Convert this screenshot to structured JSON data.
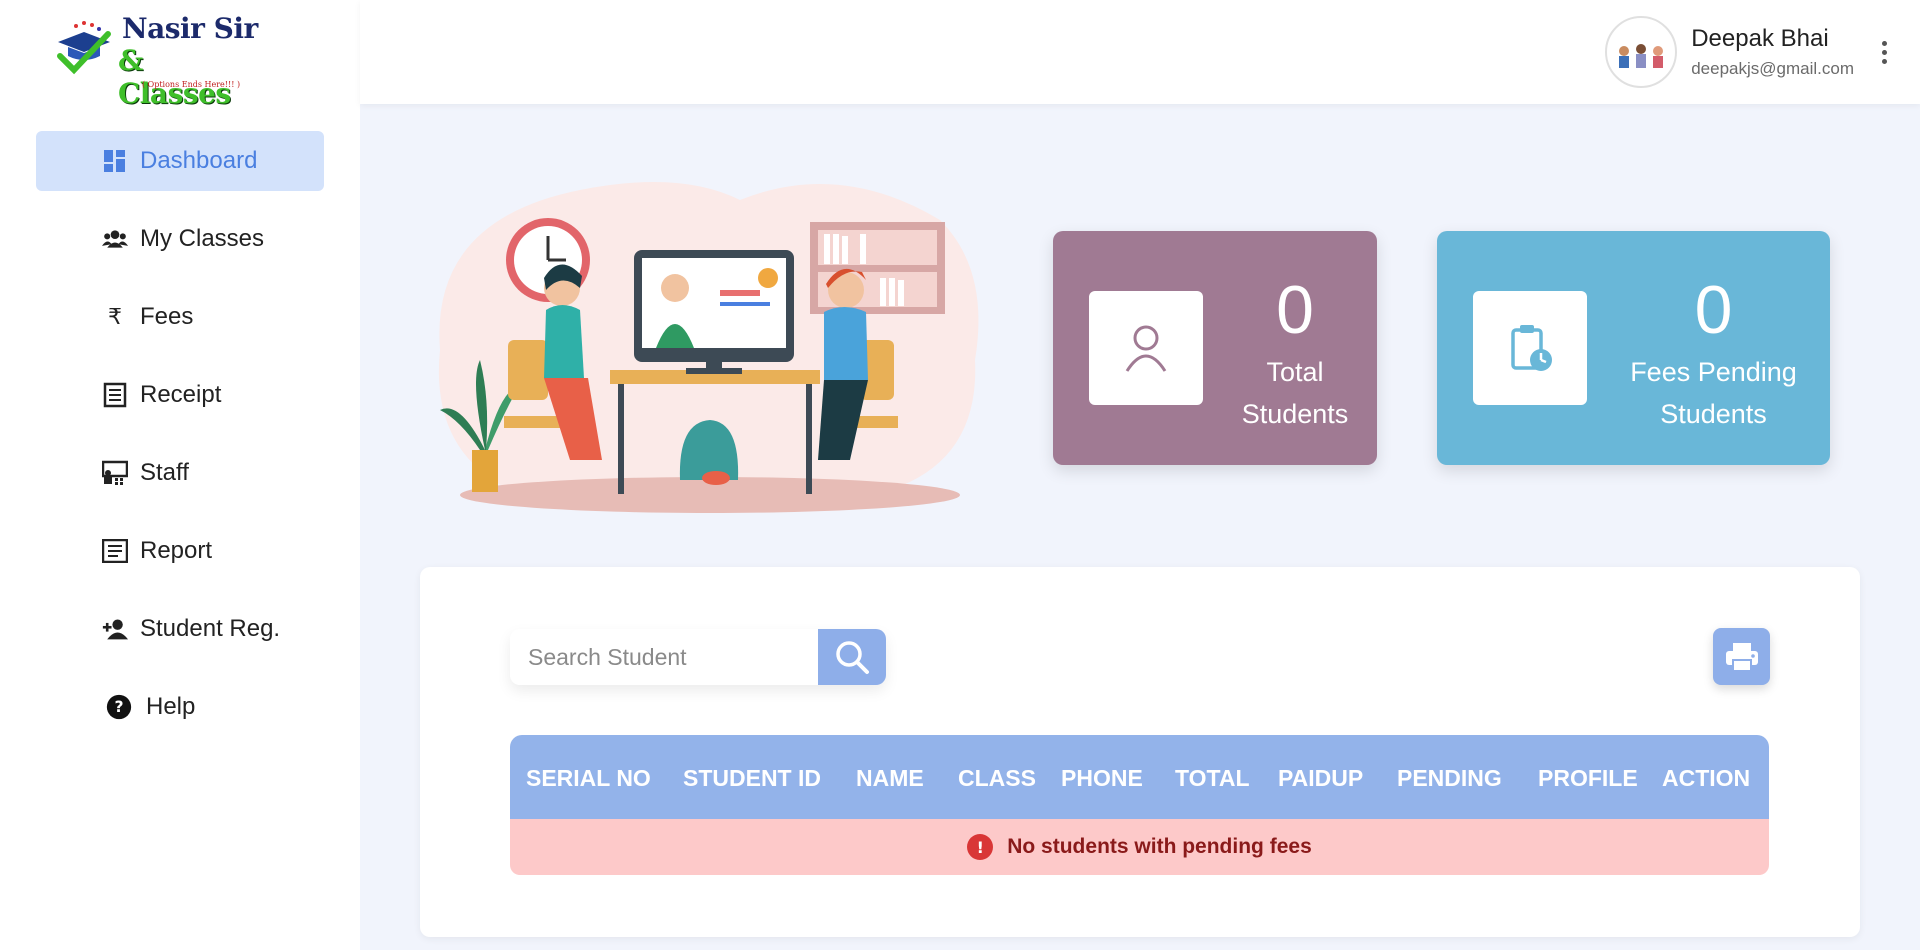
{
  "brand": {
    "line1": "Nasir Sir",
    "line2": "& Classes",
    "tagline": "( Options Ends Here!!! )"
  },
  "sidebar": {
    "items": [
      {
        "label": "Dashboard",
        "icon": "dashboard-icon",
        "active": true
      },
      {
        "label": "My Classes",
        "icon": "users-icon"
      },
      {
        "label": "Fees",
        "icon": "rupee-icon"
      },
      {
        "label": "Receipt",
        "icon": "receipt-icon"
      },
      {
        "label": "Staff",
        "icon": "staff-icon"
      },
      {
        "label": "Report",
        "icon": "report-icon"
      },
      {
        "label": "Student Reg.",
        "icon": "add-user-icon"
      },
      {
        "label": "Help",
        "icon": "help-icon"
      }
    ]
  },
  "user": {
    "name": "Deepak Bhai",
    "email": "deepakjs@gmail.com"
  },
  "stats": {
    "total_students": {
      "value": "0",
      "label_line1": "Total",
      "label_line2": "Students",
      "color": "#a07a93"
    },
    "fees_pending": {
      "value": "0",
      "label_line1": "Fees Pending",
      "label_line2": "Students",
      "color": "#69b7d8"
    }
  },
  "search": {
    "placeholder": "Search Student",
    "value": ""
  },
  "table": {
    "columns": [
      "SERIAL NO",
      "STUDENT ID",
      "NAME",
      "CLASS",
      "PHONE",
      "TOTAL",
      "PAIDUP",
      "PENDING",
      "PROFILE",
      "ACTION"
    ],
    "empty_message": "No students with pending fees"
  },
  "colors": {
    "accent": "#4a7fe0",
    "active_nav_bg": "#d3e2fb",
    "table_header": "#93b3ea",
    "error_bg": "#fdc9c9",
    "error_text": "#8a1a1a"
  }
}
